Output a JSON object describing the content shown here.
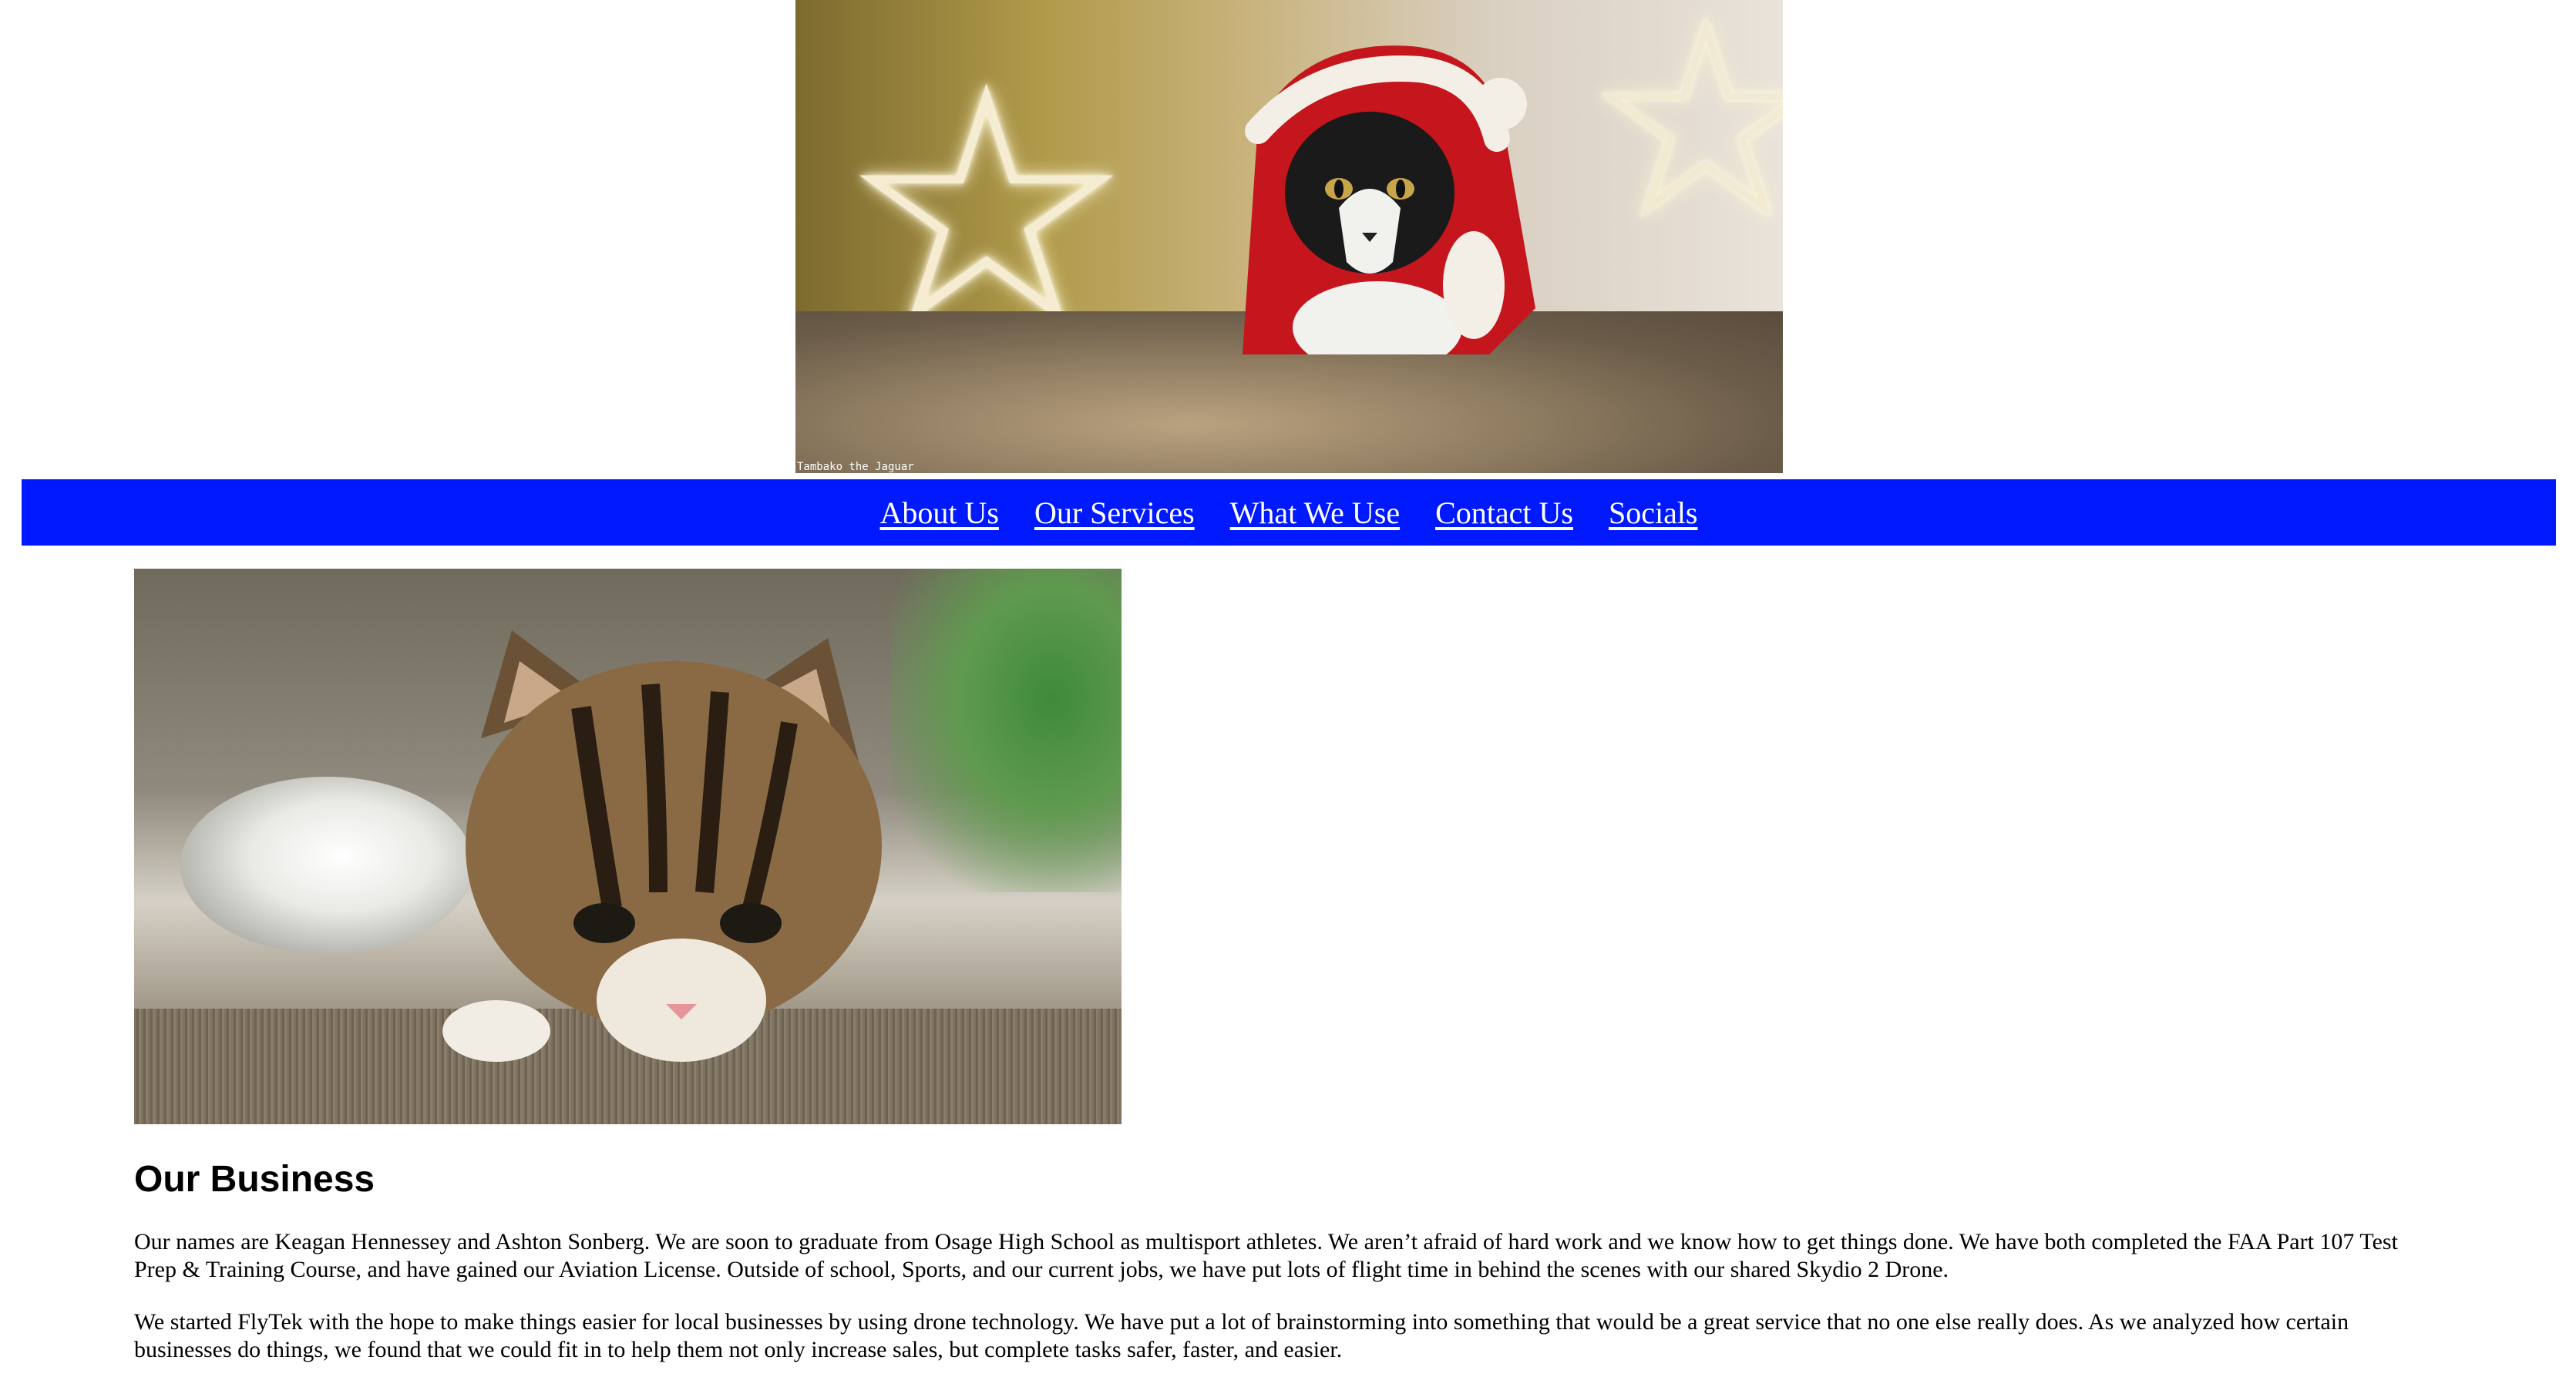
{
  "header": {
    "hero_image": {
      "description_icon": "cat-in-santa-costume-photo",
      "caption": "Tambako the Jaguar"
    }
  },
  "nav": {
    "background_color": "#0019ff",
    "items": [
      {
        "label": "About Us"
      },
      {
        "label": "Our Services"
      },
      {
        "label": "What We Use"
      },
      {
        "label": "Contact Us"
      },
      {
        "label": "Socials"
      }
    ]
  },
  "main": {
    "image": {
      "icon": "kitten-photo"
    },
    "heading": "Our Business",
    "paragraphs": [
      "Our names are Keagan Hennessey and Ashton Sonberg. We are soon to graduate from Osage High School as multisport athletes. We aren’t afraid of hard work and we know how to get things done. We have both completed the FAA Part 107 Test Prep & Training Course, and have gained our Aviation License. Outside of school, Sports, and our current jobs, we have put lots of flight time in behind the scenes with our shared Skydio 2 Drone.",
      "We started FlyTek with the hope to make things easier for local businesses by using drone technology. We have put a lot of brainstorming into something that would be a great service that no one else really does. As we analyzed how certain businesses do things, we found that we could fit in to help them not only increase sales, but complete tasks safer, faster, and easier."
    ]
  }
}
